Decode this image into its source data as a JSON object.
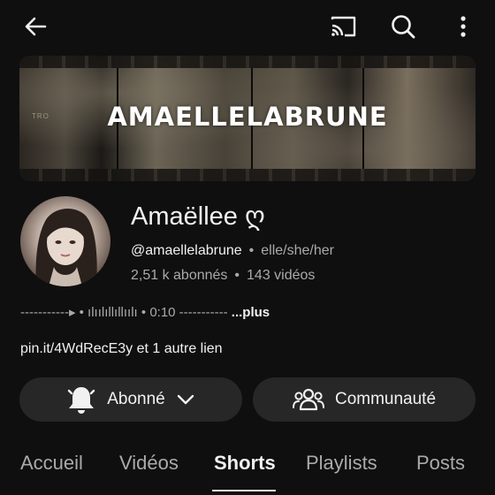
{
  "topbar": {
    "back_icon": "arrow-left-icon",
    "cast_icon": "cast-icon",
    "search_icon": "search-icon",
    "more_icon": "more-vertical-icon"
  },
  "banner": {
    "title": "AMAELLELABRUNE",
    "small_text": "TRO"
  },
  "channel": {
    "name": "Amaëllee ღ",
    "handle": "@amaellelabrune",
    "pronouns": "elle/she/her",
    "subscribers": "2,51 k abonnés",
    "videos": "143 vidéos",
    "separator": "•"
  },
  "description": {
    "text": "-----------▸ • ılıılıllıllıılı • 0:10 -----------",
    "more_label": "...plus"
  },
  "links": {
    "text": "pin.it/4WdRecE3y et 1 autre lien"
  },
  "buttons": {
    "subscribed_label": "Abonné",
    "community_label": "Communauté"
  },
  "tabs": [
    {
      "label": "Accueil"
    },
    {
      "label": "Vidéos"
    },
    {
      "label": "Shorts"
    },
    {
      "label": "Playlists"
    },
    {
      "label": "Posts"
    }
  ],
  "active_tab": "Shorts",
  "colors": {
    "background": "#0f0f0f",
    "button_bg": "#272727",
    "muted_text": "#aaaaaa",
    "text": "#f1f1f1"
  }
}
